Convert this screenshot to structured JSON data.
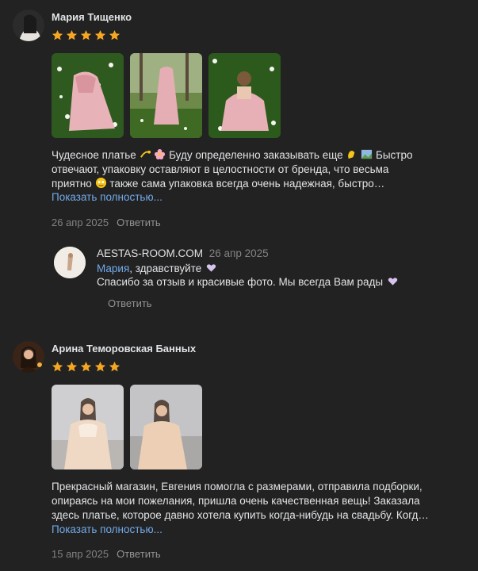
{
  "reviews": [
    {
      "name": "Мария Тищенко",
      "rating": 5,
      "text_line1_a": "Чудесное платье",
      "text_line1_b": "Буду определенно заказывать еще",
      "text_line1_c": "Быстро",
      "text_line2": "отвечают, упаковку оставляют в целостности от бренда, что весьма",
      "text_line3_a": "приятно",
      "text_line3_b": "также сама упаковка всегда очень надежная, быстро…",
      "show_more": "Показать полностью...",
      "date": "26 апр 2025",
      "reply_action": "Ответить",
      "reply": {
        "author": "AESTAS-ROOM.COM",
        "date": "26 апр 2025",
        "mention": "Мария",
        "greeting": ", здравствуйте",
        "text": "Спасибо за отзыв и красивые фото. Мы всегда Вам рады",
        "reply_action": "Ответить"
      }
    },
    {
      "name": "Арина Теморовская Банных",
      "rating": 5,
      "text_line1": "Прекрасный магазин, Евгения помогла с размерами, отправила подборки,",
      "text_line2": "опираясь на мои пожелания, пришла очень качественная вещь! Заказала",
      "text_line3": "здесь платье, которое давно хотела купить когда-нибудь на свадьбу. Когд…",
      "show_more": "Показать полностью...",
      "date": "15 апр 2025",
      "reply_action": "Ответить"
    }
  ],
  "colors": {
    "star": "#f5a623",
    "link": "#71aaeb",
    "background": "#222222"
  }
}
